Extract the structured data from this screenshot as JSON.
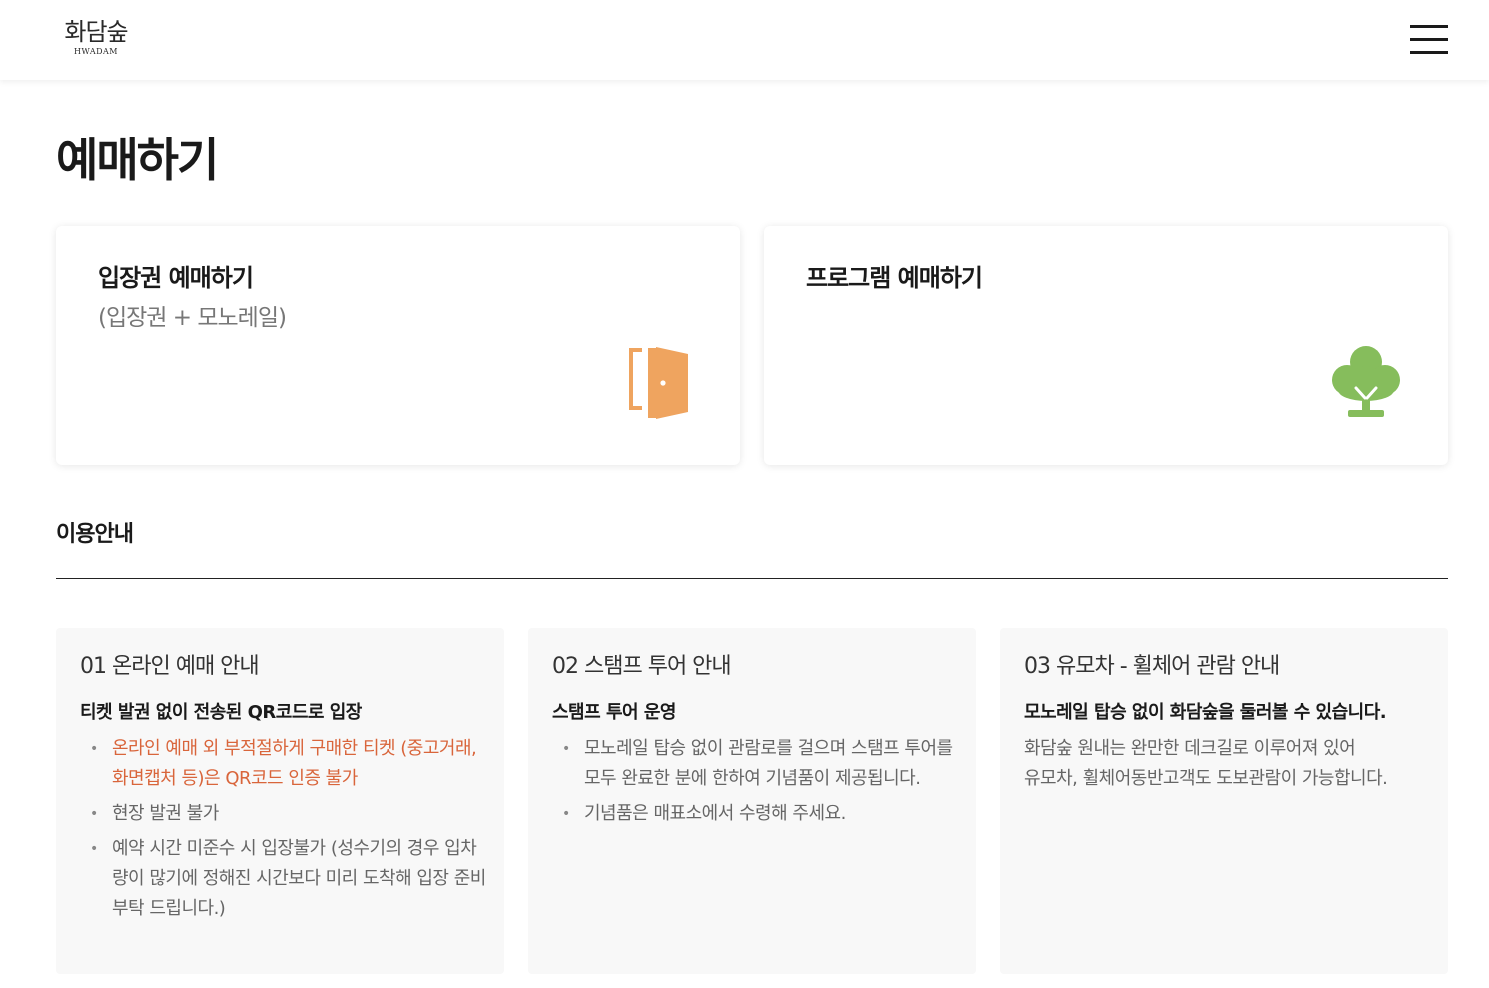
{
  "header": {
    "logo_kr": "화담숲",
    "logo_en": "HWADAM",
    "menu_icon": "hamburger-menu-icon"
  },
  "page": {
    "title": "예매하기"
  },
  "cards": [
    {
      "title": "입장권 예매하기",
      "subtitle": "(입장권 + 모노레일)",
      "icon": "door-icon",
      "icon_color": "#efa45f"
    },
    {
      "title": "프로그램 예매하기",
      "subtitle": "",
      "icon": "tree-icon",
      "icon_color": "#86bd5c"
    }
  ],
  "usage": {
    "title": "이용안내",
    "sections": [
      {
        "heading": "01 온라인 예매 안내",
        "subheading": "티켓 발권 없이 전송된 QR코드로 입장",
        "items": [
          "온라인 예매 외 부적절하게 구매한 티켓 (중고거래, 화면캡처 등)은 QR코드 인증 불가",
          "현장 발권 불가",
          "예약 시간 미준수 시 입장불가 (성수기의 경우 입차량이 많기에 정해진 시간보다 미리 도착해 입장 준비 부탁 드립니다.)"
        ]
      },
      {
        "heading": "02 스탬프 투어 안내",
        "subheading": "스탬프 투어 운영",
        "items": [
          "모노레일 탑승 없이 관람로를 걸으며 스탬프 투어를 모두 완료한 분에 한하여 기념품이 제공됩니다.",
          "기념품은 매표소에서 수령해 주세요."
        ]
      },
      {
        "heading": "03 유모차 - 휠체어 관람 안내",
        "subheading": "모노레일 탑승 없이 화담숲을 둘러볼 수 있습니다.",
        "lines": [
          "화담숲 원내는 완만한 데크길로 이루어져 있어",
          "유모차, 휠체어동반고객도 도보관람이 가능합니다."
        ]
      }
    ]
  },
  "colors": {
    "accent_warning": "#d9653b",
    "door_icon": "#efa45f",
    "tree_icon": "#86bd5c"
  }
}
